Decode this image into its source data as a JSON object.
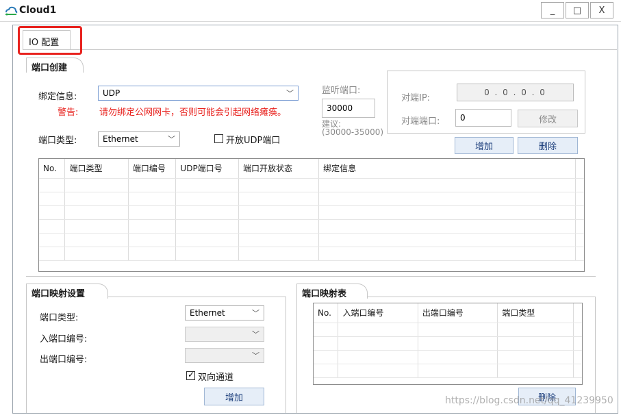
{
  "window": {
    "title": "Cloud1",
    "minimize": "_",
    "maximize": "□",
    "close": "X"
  },
  "tabs": [
    {
      "label": "IO 配置"
    }
  ],
  "port_create": {
    "group_title": "端口创建",
    "bind_label": "绑定信息:",
    "bind_value": "UDP",
    "warning_label": "警告:",
    "warning_text": "请勿绑定公网网卡，否则可能会引起网络瘫痪。",
    "listen_label": "监听端口:",
    "listen_value": "30000",
    "suggest_label": "建议:",
    "suggest_range": "(30000-35000)",
    "port_type_label": "端口类型:",
    "port_type_value": "Ethernet",
    "open_udp_label": "开放UDP端口",
    "open_udp_checked": false,
    "peer_ip_label": "对端IP:",
    "peer_ip_value": "0 . 0 . 0 . 0",
    "peer_port_label": "对端端口:",
    "peer_port_value": "0",
    "modify_label": "修改",
    "add_label": "增加",
    "delete_label": "删除",
    "columns": [
      "No.",
      "端口类型",
      "端口编号",
      "UDP端口号",
      "端口开放状态",
      "绑定信息"
    ]
  },
  "mapping_settings": {
    "group_title": "端口映射设置",
    "port_type_label": "端口类型:",
    "port_type_value": "Ethernet",
    "in_port_label": "入端口编号:",
    "out_port_label": "出端口编号:",
    "bidirectional_label": "双向通道",
    "bidirectional_checked": true,
    "add_label": "增加"
  },
  "mapping_table": {
    "group_title": "端口映射表",
    "columns": [
      "No.",
      "入端口编号",
      "出端口编号",
      "端口类型"
    ],
    "delete_label": "删除"
  },
  "watermark": "https://blog.csdn.net/qq_41239950",
  "colors": {
    "highlight": "#e8231f",
    "warning": "#e8231f",
    "border": "#c6c6c6"
  }
}
